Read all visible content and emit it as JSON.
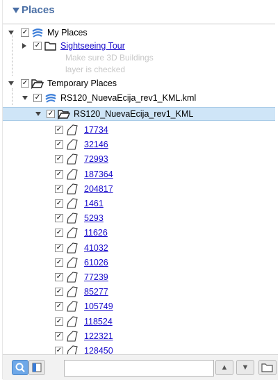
{
  "panel": {
    "title": "Places"
  },
  "tree": {
    "my_places": {
      "label": "My Places"
    },
    "sightseeing": {
      "label": "Sightseeing Tour",
      "desc1": "Make sure 3D Buildings",
      "desc2": "layer is checked"
    },
    "temporary": {
      "label": "Temporary Places"
    },
    "kml_file": {
      "label": "RS120_NuevaEcija_rev1_KML.kml"
    },
    "kml_folder": {
      "label": "RS120_NuevaEcija_rev1_KML"
    },
    "items": [
      "17734",
      "32146",
      "72993",
      "187364",
      "204817",
      "1461",
      "5293",
      "11626",
      "41032",
      "61026",
      "77239",
      "85277",
      "105749",
      "118524",
      "122321",
      "128450"
    ]
  },
  "icons": {
    "globe": "globe-icon",
    "folder": "folder-icon",
    "polygon": "polygon-icon"
  },
  "colors": {
    "header_text": "#4a6fa5",
    "link": "#1a0dcc",
    "selection": "#cfe5f7"
  },
  "bottom_bar": {
    "search_value": "",
    "up_glyph": "▲",
    "down_glyph": "▼"
  }
}
